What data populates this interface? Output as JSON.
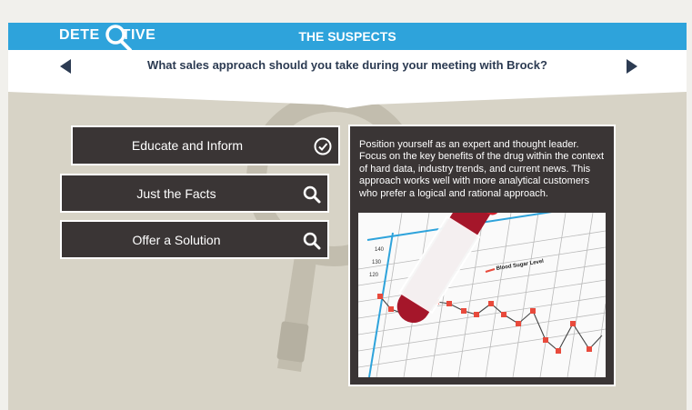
{
  "header": {
    "brand_left": "DETE",
    "brand_right": "TIVE",
    "section_title": "THE SUSPECTS"
  },
  "question": "What sales approach should you take during your meeting with Brock?",
  "nav": {
    "prev_icon": "triangle-left-icon",
    "next_icon": "triangle-right-icon"
  },
  "choices": [
    {
      "label": "Educate and Inform",
      "icon": "checkmark-circle-icon",
      "state": "completed"
    },
    {
      "label": "Just the Facts",
      "icon": "search-icon",
      "state": "unvisited"
    },
    {
      "label": "Offer a Solution",
      "icon": "search-icon",
      "state": "unvisited"
    }
  ],
  "detail": {
    "text": "Position yourself as an expert and thought leader. Focus on the key benefits of the drug within the context of hard data, industry trends, and current news. This approach works well with more analytical customers who prefer a logical and rational approach.",
    "image": {
      "legend": "Blood Sugar Level",
      "ticks": [
        "140",
        "130",
        "120"
      ]
    }
  },
  "colors": {
    "accent_blue": "#2ea3db",
    "stage_bg": "#d7d3c6",
    "panel_dark": "#3a3535",
    "question_text": "#2c3b52",
    "chart_point": "#e84a3c"
  }
}
